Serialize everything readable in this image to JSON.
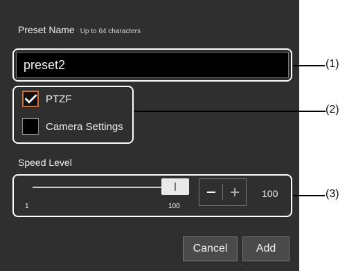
{
  "dialog": {
    "preset_name_label": "Preset Name",
    "preset_name_hint": "Up to 64 characters",
    "preset_name_value": "preset2",
    "options": [
      {
        "label": "PTZF",
        "checked": true
      },
      {
        "label": "Camera Settings",
        "checked": false
      }
    ],
    "speed_level_label": "Speed Level",
    "slider_min": "1",
    "slider_max": "100",
    "speed_value": "100",
    "buttons": {
      "cancel": "Cancel",
      "add": "Add"
    }
  },
  "callouts": [
    "(1)",
    "(2)",
    "(3)"
  ],
  "colors": {
    "dialog_background": "#2f2f2f",
    "input_background": "#000000",
    "callout_outline": "#ffffff",
    "checkbox_accent": "#d16b2f"
  },
  "icons": {
    "checked": "check-icon",
    "minus": "minus-icon",
    "plus": "plus-icon"
  }
}
